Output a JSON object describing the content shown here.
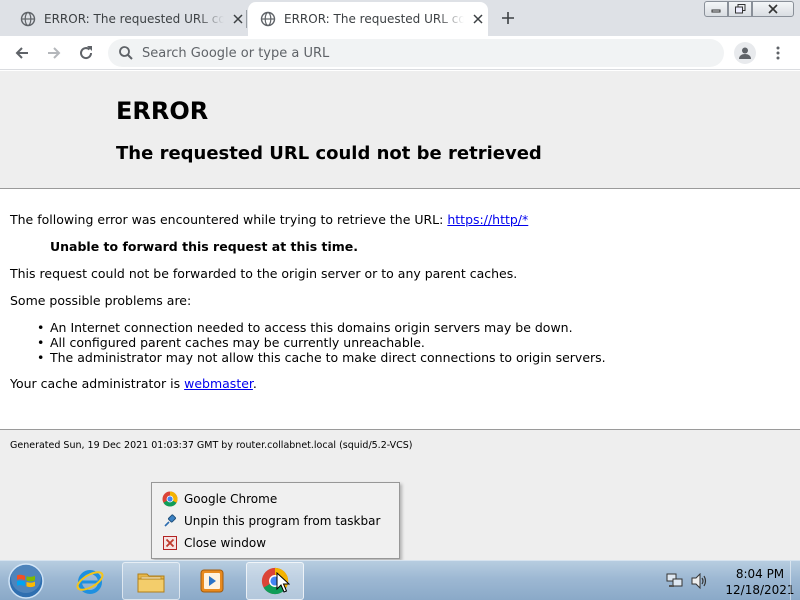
{
  "browser": {
    "tabs": [
      {
        "title": "ERROR: The requested URL could not be retrieved",
        "active": false
      },
      {
        "title": "ERROR: The requested URL could not be retrieved",
        "active": true
      }
    ],
    "omnibox_placeholder": "Search Google or type a URL",
    "window_controls": [
      "minimize",
      "maximize",
      "close"
    ]
  },
  "page": {
    "heading": "ERROR",
    "subheading": "The requested URL could not be retrieved",
    "intro_text": "The following error was encountered while trying to retrieve the URL: ",
    "url_link": "https://http/*",
    "error_detail": "Unable to forward this request at this time.",
    "description": "This request could not be forwarded to the origin server or to any parent caches.",
    "problems_label": "Some possible problems are:",
    "problems": [
      "An Internet connection needed to access this domains origin servers may be down.",
      "All configured parent caches may be currently unreachable.",
      "The administrator may not allow this cache to make direct connections to origin servers."
    ],
    "admin_prefix": "Your cache administrator is ",
    "admin_link": "webmaster",
    "admin_suffix": ".",
    "footer": "Generated Sun, 19 Dec 2021 01:03:37 GMT by router.collabnet.local (squid/5.2-VCS)"
  },
  "jumplist": {
    "items": [
      {
        "label": "Google Chrome",
        "icon": "chrome-icon"
      },
      {
        "label": "Unpin this program from taskbar",
        "icon": "unpin-icon"
      },
      {
        "label": "Close window",
        "icon": "close-window-icon"
      }
    ]
  },
  "taskbar": {
    "apps": [
      "internet-explorer-icon",
      "windows-explorer-icon",
      "media-player-icon",
      "chrome-icon"
    ],
    "clock_time": "8:04 PM",
    "clock_date": "12/18/2021"
  },
  "colors": {
    "link": "#0000ee",
    "page_band": "#eeeeee",
    "tabstrip": "#dee1e6"
  }
}
